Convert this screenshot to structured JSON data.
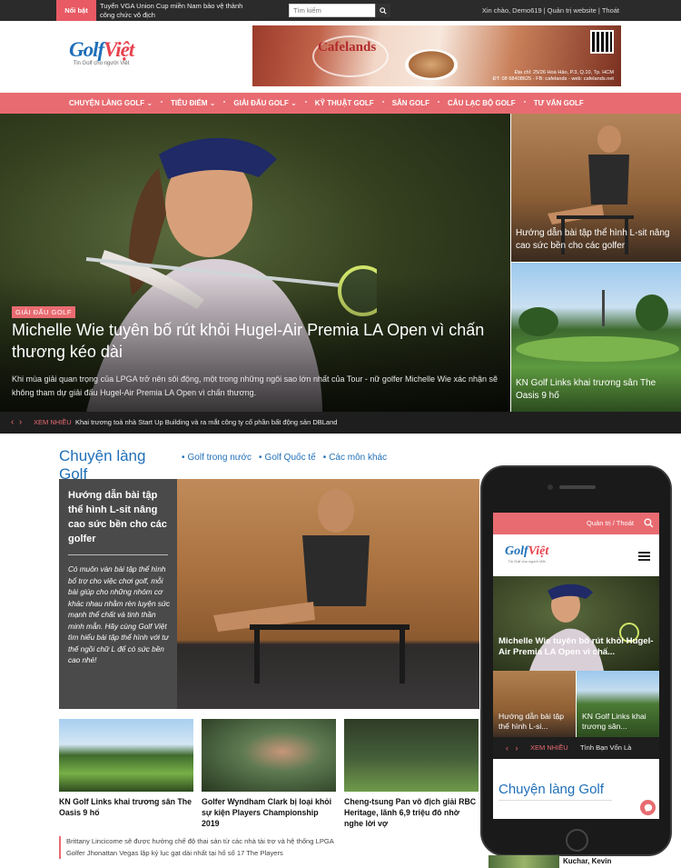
{
  "topbar": {
    "hot_label": "Nổi bật",
    "ticker": "Tuyển VGA Union Cup miền Nam bảo vệ thành công chức vô địch",
    "search_placeholder": "Tìm kiếm",
    "greeting": "Xin chào, Demo619",
    "admin": "Quản trị website",
    "logout": "Thoát"
  },
  "logo": {
    "brand_a": "Golf",
    "brand_b": "Việt",
    "tagline": "Tin Golf cho người Việt"
  },
  "banner": {
    "brand": "Cafelands",
    "address": "Địa chỉ: 25/26 Hoà Hảo, P.3, Q.10, Tp. HCM",
    "contact": "ĐT: 08 68408625 - FB: cafelands - web: cafelands.net"
  },
  "nav": [
    {
      "label": "CHUYỆN LÀNG GOLF ⌄"
    },
    {
      "label": "TIÊU ĐIỂM ⌄"
    },
    {
      "label": "GIẢI ĐẤU GOLF ⌄"
    },
    {
      "label": "KỸ THUẬT GOLF"
    },
    {
      "label": "SÂN GOLF"
    },
    {
      "label": "CÂU LẠC BỘ GOLF"
    },
    {
      "label": "TƯ VẤN GOLF"
    }
  ],
  "hero": {
    "category": "GIẢI ĐẤU GOLF",
    "title": "Michelle Wie tuyên bố rút khỏi Hugel-Air Premia LA Open vì chấn thương kéo dài",
    "excerpt": "Khi mùa giải quan trọng của LPGA trở nên sôi động, một trong những ngôi sao lớn nhất của Tour - nữ golfer Michelle Wie xác nhận sẽ không tham dự giải đấu Hugel-Air Premia LA Open vì chấn thương."
  },
  "side_cards": [
    {
      "caption": "Hướng dẫn bài tập thể hình L-sit nâng cao sức bền cho các golfer"
    },
    {
      "caption": "KN Golf Links khai trương sân The Oasis 9 hố"
    }
  ],
  "newsbar": {
    "label": "XEM NHIỀU",
    "text": "Khai trương toà nhà Start Up Building và ra mắt công ty cổ phần bất động sản DBLand"
  },
  "section": {
    "title": "Chuyện làng Golf",
    "tabs": [
      "Golf trong nước",
      "Golf Quốc tế",
      "Các môn khác"
    ]
  },
  "feature": {
    "title": "Hướng dẫn bài tập thể hình L-sit nâng cao sức bền cho các golfer",
    "excerpt": "Có muôn vàn bài tập thể hình bổ trợ cho việc chơi golf, mỗi bài giúp cho những nhóm cơ khác nhau nhằm rèn luyện sức mạnh thể chất và tinh thần minh mẫn. Hãy cùng Golf Việt tìm hiểu bài tập thể hình với tư thế ngồi chữ L để có sức bền cao nhé!"
  },
  "thumbs": [
    {
      "title": "KN Golf Links khai trương sân The Oasis 9 hố"
    },
    {
      "title": "Golfer Wyndham Clark bị loại khỏi sự kiện Players Championship 2019"
    },
    {
      "title": "Cheng-tsung Pan vô địch giải RBC Heritage, lãnh 6,9 triệu đô nhờ nghe lời vợ"
    }
  ],
  "more_list": [
    "Brittany Lincicome sẽ được hưởng chế độ thai sản từ các nhà tài trợ và hệ thống LPGA",
    "Golfer Jhonattan Vegas lập kỷ lục gạt dài nhất tại hố số 17 The Players"
  ],
  "mobile": {
    "links": "Quản trị  /  Thoát",
    "hero_title": "Michelle Wie tuyên bố rút khỏi Hugel-Air Premia LA Open vì chấ...",
    "card_a": "Hướng dẫn bài tập thể hình L-si...",
    "card_b": "KN Golf Links khai trương sân...",
    "ticker_label": "XEM NHIỀU",
    "ticker_text": "Tình Bạn Vốn Là",
    "section_title": "Chuyện làng Golf"
  },
  "peek": {
    "text": "Kuchar, Kevin"
  },
  "colors": {
    "accent": "#e86b71",
    "brand_blue": "#1f6fb8",
    "brand_red": "#e8434e",
    "dark": "#1e1e1e"
  }
}
